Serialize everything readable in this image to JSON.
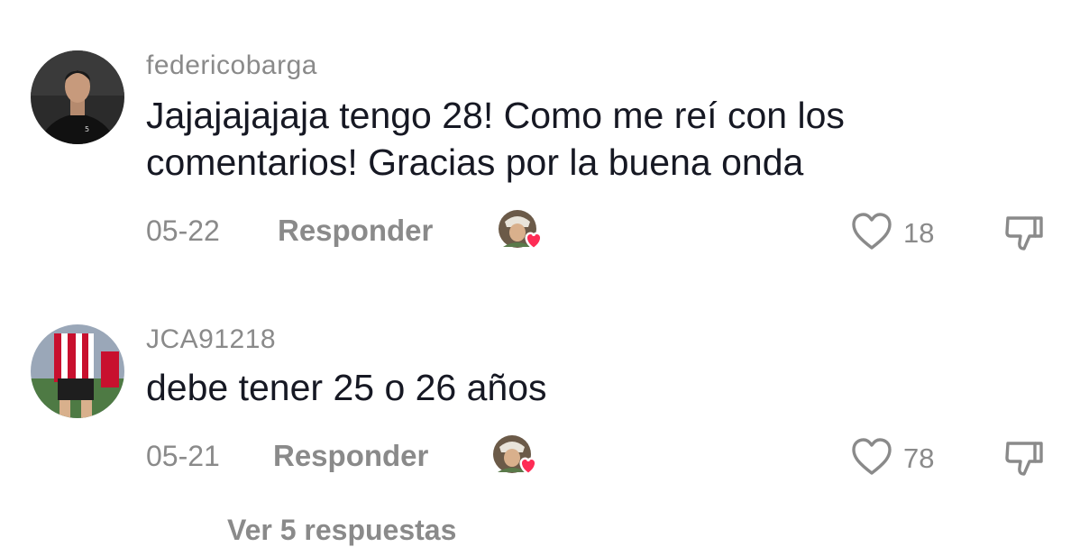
{
  "comments": [
    {
      "username": "federicobarga",
      "text_line1": "Jajajajajaja tengo 28! Como me reí con los",
      "text_line2": "comentarios! Gracias por la buena onda",
      "date": "05-22",
      "reply_label": "Responder",
      "likes": "18"
    },
    {
      "username": "JCA91218",
      "text_line1": "debe tener 25 o 26 años",
      "date": "05-21",
      "reply_label": "Responder",
      "likes": "78"
    }
  ],
  "view_replies_label": "Ver 5 respuestas",
  "colors": {
    "heart_accent": "#fe2c55",
    "muted_text": "#8a8a8a",
    "main_text": "#161823"
  },
  "icons": {
    "like": "heart-outline-icon",
    "dislike": "thumbs-down-icon",
    "creator_liked": "creator-liked-badge-icon"
  }
}
